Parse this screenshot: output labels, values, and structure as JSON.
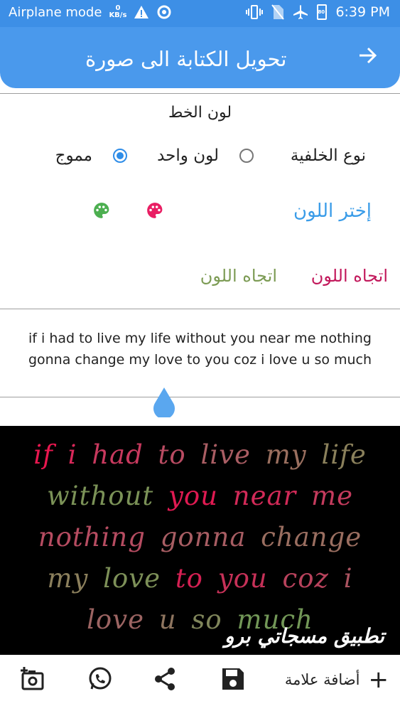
{
  "status_bar": {
    "left_text": "Airplane mode",
    "data_speed_value": "0",
    "data_speed_unit": "KB/s",
    "time": "6:39 PM",
    "battery": "80"
  },
  "app_bar": {
    "title": "تحويل الكتابة الى صورة",
    "back_icon": "arrow-right-icon"
  },
  "font_color_section": {
    "title": "لون الخط",
    "background_type_label": "نوع الخلفية",
    "options": [
      {
        "label": "لون واحد",
        "checked": false
      },
      {
        "label": "مموج",
        "checked": true
      }
    ],
    "choose_color_label": "إختر اللون",
    "palette_colors": [
      "#e91e63",
      "#4caf50"
    ],
    "direction_buttons": [
      {
        "label": "اتجاه اللون",
        "color": "#c2185b"
      },
      {
        "label": "اتجاه اللون",
        "color": "#7c9b54"
      }
    ]
  },
  "input": {
    "text": "if i had to live my life without you near me nothing gonna change my love to you coz i love u so much"
  },
  "preview": {
    "words": [
      "if",
      "i",
      "had",
      "to",
      "live",
      "my",
      "life",
      "without",
      "you",
      "near",
      "me",
      "nothing",
      "gonna",
      "change",
      "my",
      "love",
      "to",
      "you",
      "coz",
      "i",
      "love",
      "u",
      "so",
      "much"
    ],
    "colors": [
      "#e8174f",
      "#d9285a",
      "#c8395e",
      "#b94b62",
      "#a95d63",
      "#9a6f5f",
      "#8a805b",
      "#7b9257",
      "#e01a52",
      "#d22a58",
      "#c43b5d",
      "#b64c61",
      "#a85d63",
      "#9a6e60",
      "#8b7f5c",
      "#7d9058",
      "#d52053",
      "#c63158",
      "#b8425c",
      "#aa5360",
      "#9c6462",
      "#8e755f",
      "#80865b",
      "#729757"
    ],
    "watermark": "تطبيق مسجاتي برو"
  },
  "bottom_bar": {
    "add_mark_label": "أضافة علامة"
  }
}
